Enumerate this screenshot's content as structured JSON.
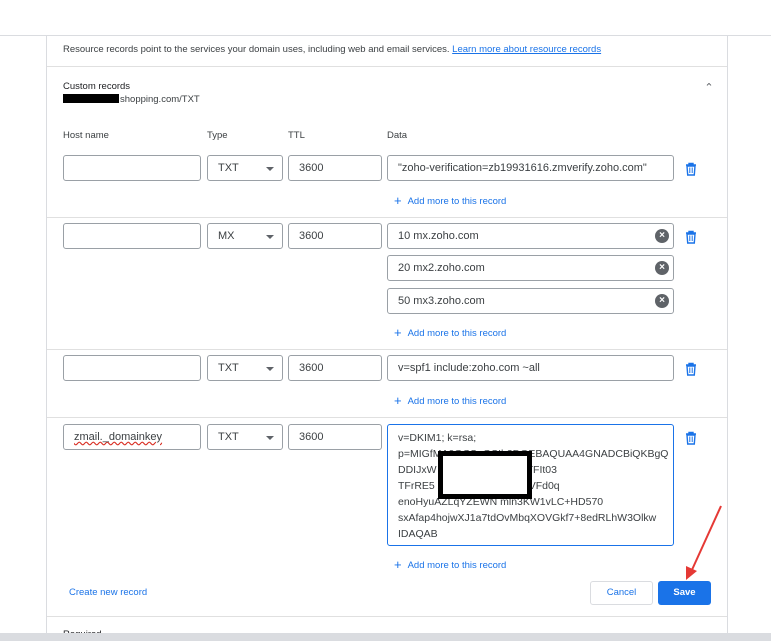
{
  "intro": {
    "text": "Resource records point to the services your domain uses, including web and email services.",
    "link": "Learn more about resource records"
  },
  "custom": {
    "title": "Custom records",
    "subtitle_suffix": "shopping.com/TXT"
  },
  "columns": {
    "host": "Host name",
    "type": "Type",
    "ttl": "TTL",
    "data": "Data"
  },
  "records": [
    {
      "host": "",
      "type": "TXT",
      "ttl": "3600",
      "data": [
        "\"zoho-verification=zb19931616.zmverify.zoho.com\""
      ]
    },
    {
      "host": "",
      "type": "MX",
      "ttl": "3600",
      "data": [
        "10 mx.zoho.com",
        "20 mx2.zoho.com",
        "50 mx3.zoho.com"
      ]
    },
    {
      "host": "",
      "type": "TXT",
      "ttl": "3600",
      "data": [
        "v=spf1 include:zoho.com ~all"
      ]
    },
    {
      "host": "zmail._domainkey",
      "type": "TXT",
      "ttl": "3600",
      "data_lines": [
        "v=DKIM1; k=rsa;",
        "p=MIGfMA0GCSqGSIb3DQEBAQUAA4GNADCBiQKBgQ",
        "DDIJxW                              udmt/uFrt+u8SHWTFIt03",
        "TFrRE5                              ZpG73XkMS2h1HnVFd0q",
        "enoHyuAZLqYZEWN              mln3KW1vLC+HD570",
        "sxAfap4hojwXJ1a7tdOvMbqXOVGkf7+8edRLhW3Olkw",
        "IDAQAB"
      ]
    }
  ],
  "add_more_label": "Add more to this record",
  "actions": {
    "create": "Create new record",
    "cancel": "Cancel",
    "save": "Save"
  },
  "required_label": "Required",
  "colors": {
    "accent": "#1a73e8",
    "annotation_arrow": "#e53935"
  },
  "icons": {
    "trash": "trash-icon",
    "clear": "clear-icon",
    "chevron": "chevron-up-icon",
    "add": "plus-icon"
  }
}
